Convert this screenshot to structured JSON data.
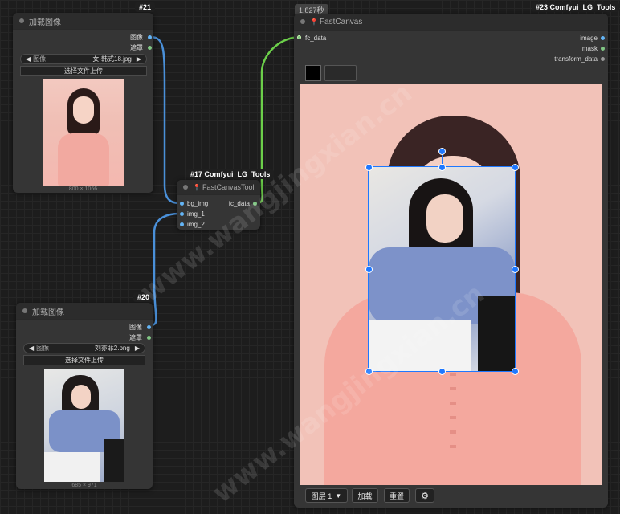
{
  "node21": {
    "id": "#21",
    "title": "加载图像",
    "outputs": [
      "图像",
      "遮罩"
    ],
    "image_label": "图像",
    "image_value": "女-韩式18.jpg",
    "upload_label": "选择文件上传",
    "size": "800 × 1066"
  },
  "node20": {
    "id": "#20",
    "title": "加载图像",
    "outputs": [
      "图像",
      "遮罩"
    ],
    "image_label": "图像",
    "image_value": "刘亦菲2.png",
    "upload_label": "选择文件上传",
    "size": "685 × 971"
  },
  "node17": {
    "id": "#17 Comfyui_LG_Tools",
    "title": "FastCanvasTool",
    "inputs": [
      "bg_img",
      "img_1",
      "img_2"
    ],
    "output": "fc_data"
  },
  "node23": {
    "id": "#23 Comfyui_LG_Tools",
    "timing": "1.827秒",
    "title": "FastCanvas",
    "input": "fc_data",
    "outputs": [
      "image",
      "mask",
      "transform_data"
    ],
    "toolbar": {
      "layer_label": "图层 1",
      "add_label": "加载",
      "reset_label": "重置",
      "settings_icon": "gear-icon"
    }
  },
  "colors": {
    "image_socket": "#64b5f6",
    "mask_socket": "#81c784",
    "link_blue": "#4a90d9",
    "link_green": "#6ccf4a",
    "handle": "#1e78ff"
  },
  "watermark": "www.wangjingxian.cn"
}
